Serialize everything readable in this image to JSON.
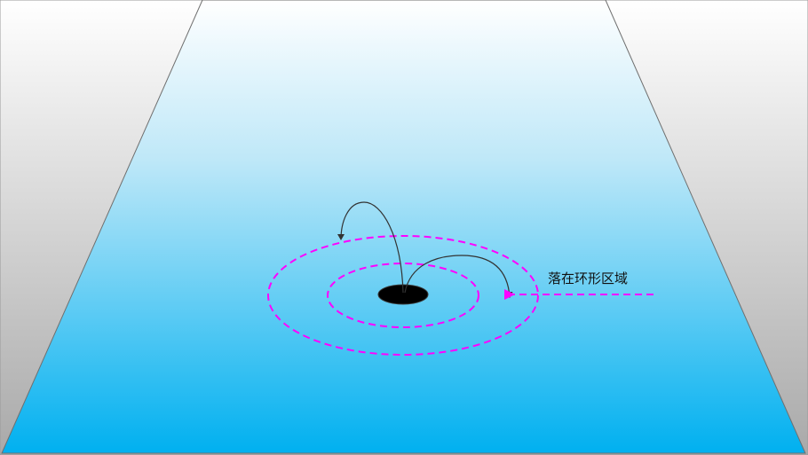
{
  "annotation": {
    "text": "落在环形区域"
  },
  "colors": {
    "background_gradient_top": "#ffffff",
    "background_gradient_bottom": "#a9a9a9",
    "plane_gradient_top": "#ffffff",
    "plane_gradient_bottom": "#00b0f0",
    "ring_dash": "#ff00ff",
    "hole": "#000000",
    "trajectory": "#333333"
  },
  "elements": {
    "hole": "hole",
    "rings": [
      "inner-ring",
      "outer-ring"
    ],
    "trajectories": [
      "ball-trajectory-small",
      "ball-trajectory-large"
    ],
    "pointer": "pointer-arrow"
  }
}
